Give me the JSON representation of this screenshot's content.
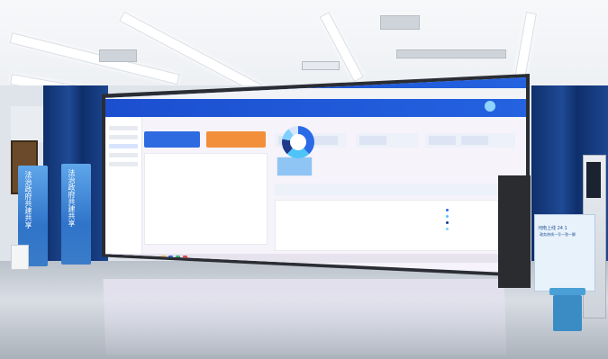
{
  "scene": {
    "description_tags": [
      "lobby",
      "led-wall",
      "banners",
      "kiosk"
    ],
    "colors": {
      "screen_header": "#1b4fd0",
      "curtain": "#0f2f6b",
      "banner_blue": "#2f74c9",
      "accent_orange": "#f28f3b"
    }
  },
  "left_banners": [
    {
      "text": "法治政府共建共享"
    },
    {
      "text": "法治政府共建共享"
    }
  ],
  "poster": {
    "title": "河南上线 24 1",
    "subtitle": "政务热线一号一答一解"
  },
  "dashboard": {
    "tiles": [
      {
        "label": "",
        "color": "#2f6be0"
      },
      {
        "label": "",
        "color": "#f28f3b"
      }
    ],
    "donut": {
      "segments": [
        0.38,
        0.24,
        0.16,
        0.12,
        0.1
      ]
    }
  }
}
